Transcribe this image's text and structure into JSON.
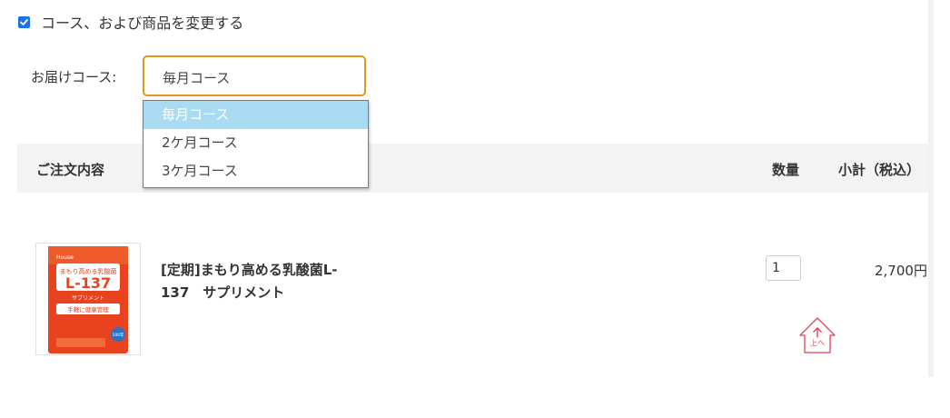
{
  "change_option": {
    "checked": true,
    "label": "コース、および商品を変更する"
  },
  "course": {
    "label": "お届けコース:",
    "selected": "毎月コース",
    "options": [
      "毎月コース",
      "2ケ月コース",
      "3ケ月コース"
    ]
  },
  "order_table": {
    "headers": {
      "content": "ご注文内容",
      "quantity": "数量",
      "subtotal": "小計（税込）"
    },
    "items": [
      {
        "name_line1": "[定期]まもり高める乳酸菌L-",
        "name_line2": "137　サプリメント",
        "quantity": "1",
        "subtotal": "2,700円",
        "image": {
          "brand": "House",
          "title": "まもり高める乳酸菌",
          "big": "L-137",
          "sub": "サプリメント",
          "tagline": "手軽に健康管理",
          "badge": "100年"
        }
      }
    ]
  },
  "scroll_top": {
    "label": "上へ"
  },
  "colors": {
    "accent": "#d89b1c",
    "selected_option": "#a9dcf2",
    "checkbox": "#1a73e8",
    "scroll_top": "#e0435a"
  }
}
